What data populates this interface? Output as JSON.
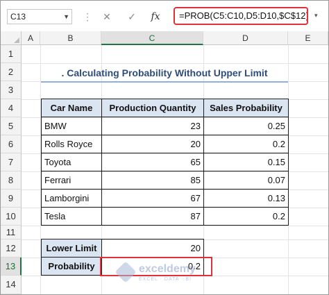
{
  "formula_bar": {
    "name_box": "C13",
    "cancel_icon": "✕",
    "enter_icon": "✓",
    "fx_label": "fx",
    "formula": "=PROB(C5:C10,D5:D10,$C$12)"
  },
  "columns": [
    "A",
    "B",
    "C",
    "D",
    "E"
  ],
  "rows": [
    "1",
    "2",
    "3",
    "4",
    "5",
    "6",
    "7",
    "8",
    "9",
    "10",
    "11",
    "12",
    "13",
    "14"
  ],
  "selected_cell": "C13",
  "title": ". Calculating Probability Without Upper Limit",
  "table": {
    "headers": [
      "Car Name",
      "Production Quantity",
      "Sales Probability"
    ],
    "rows": [
      {
        "name": "BMW",
        "qty": "23",
        "prob": "0.25"
      },
      {
        "name": "Rolls Royce",
        "qty": "20",
        "prob": "0.2"
      },
      {
        "name": "Toyota",
        "qty": "65",
        "prob": "0.15"
      },
      {
        "name": "Ferrari",
        "qty": "85",
        "prob": "0.07"
      },
      {
        "name": "Lamborgini",
        "qty": "67",
        "prob": "0.13"
      },
      {
        "name": "Tesla",
        "qty": "87",
        "prob": "0.2"
      }
    ]
  },
  "limits": {
    "lower_label": "Lower Limit",
    "lower_value": "20",
    "prob_label": "Probability",
    "prob_value": "0.2"
  },
  "watermark": {
    "name": "exceldemy",
    "tagline": "EXCEL · DATA · BI"
  },
  "colors": {
    "header_fill": "#dbe4f1",
    "highlight": "#e0303a",
    "title_text": "#2e4d78",
    "selection": "#217346"
  }
}
